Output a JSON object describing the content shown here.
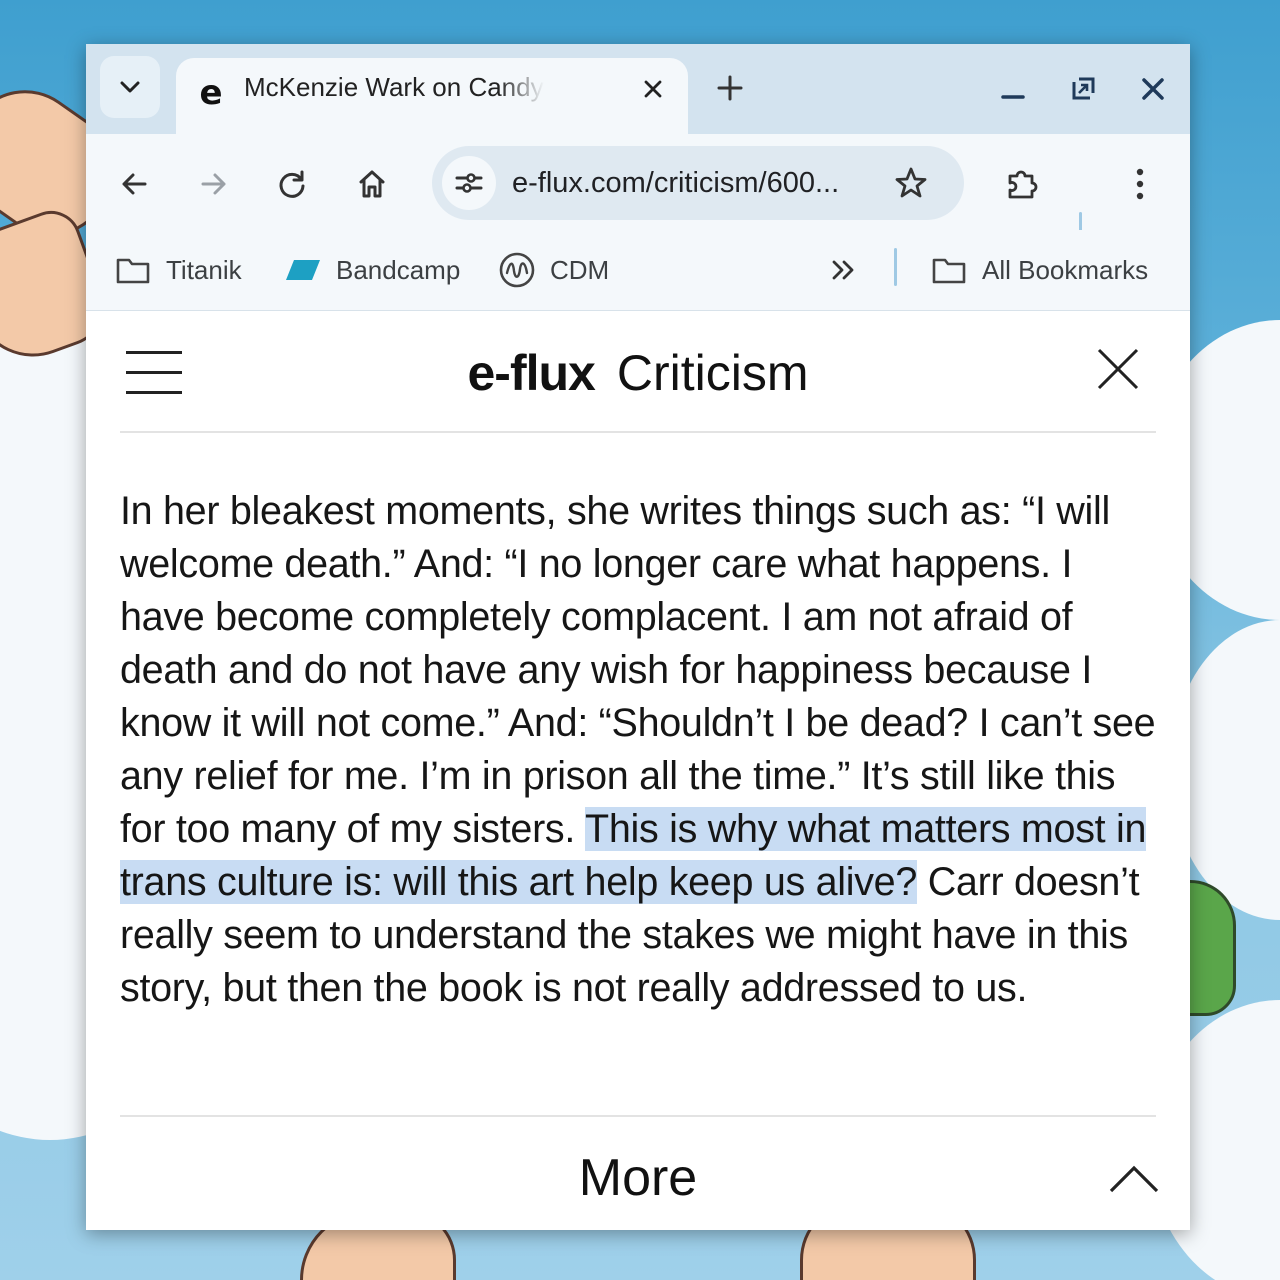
{
  "browser": {
    "tab": {
      "favicon_letter": "e",
      "title": "McKenzie Wark on Candy Darling"
    },
    "url": "e-flux.com/criticism/600...",
    "bookmarks": [
      {
        "label": "Titanik",
        "icon": "folder-icon"
      },
      {
        "label": "Bandcamp",
        "icon": "bandcamp-icon"
      },
      {
        "label": "CDM",
        "icon": "cdm-icon"
      }
    ],
    "all_bookmarks_label": "All Bookmarks"
  },
  "site": {
    "logo": "e-flux",
    "section": "Criticism"
  },
  "article": {
    "text_before": "In her bleakest moments, she writes things such as: “I will welcome death.” And: “I no longer care what happens. I have become completely complacent. I am not afraid of death and do not have any wish for happiness because I know it will not come.” And: “Shouldn’t I be dead? I can’t see any relief for me. I’m in prison all the time.” It’s still like this for too many of my sisters. ",
    "text_selected": "This is why what matters most in trans culture is: will this art help keep us alive?",
    "text_after": " Carr doesn’t really seem to understand the stakes we might have in this story, but then the book is not really addressed to us."
  },
  "footer": {
    "more_label": "More"
  },
  "colors": {
    "tabstrip": "#d3e3ef",
    "toolbar": "#f4f8fb",
    "omnibox": "#dfe9f1",
    "selection": "#c8dcf3"
  }
}
